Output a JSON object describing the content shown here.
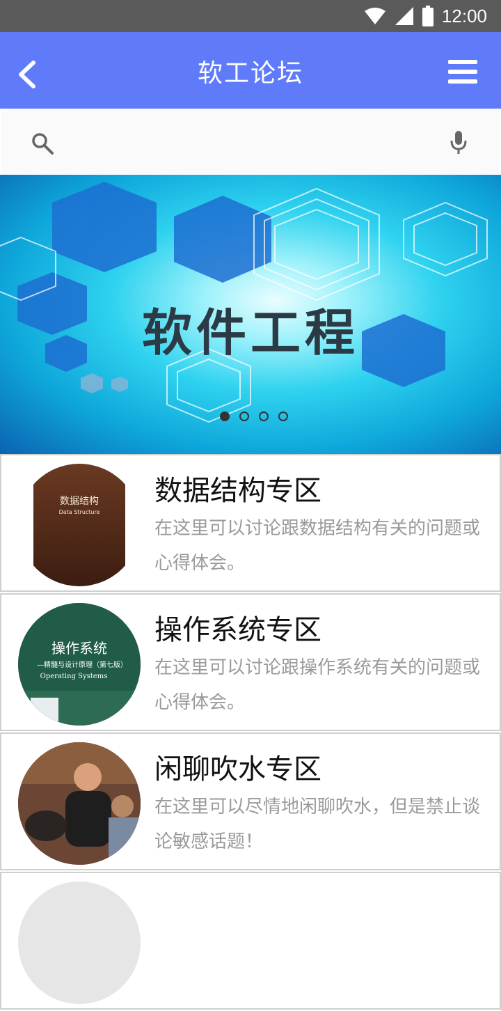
{
  "status_bar": {
    "time": "12:00"
  },
  "app_bar": {
    "title": "软工论坛"
  },
  "search": {
    "placeholder": ""
  },
  "banner": {
    "title": "软件工程",
    "pages": 4,
    "active_page": 1
  },
  "forums": [
    {
      "title": "数据结构专区",
      "description": "在这里可以讨论跟数据结构有关的问题或心得体会。",
      "cover_text": "数据结构",
      "cover_subtext": "Data Structure"
    },
    {
      "title": "操作系统专区",
      "description": "在这里可以讨论跟操作系统有关的问题或心得体会。",
      "cover_text": "操作系统",
      "cover_subtext": "—精髓与设计原理（第七版）",
      "cover_subtext2": "Operating Systems"
    },
    {
      "title": "闲聊吹水专区",
      "description": "在这里可以尽情地闲聊吹水，但是禁止谈论敏感话题！"
    }
  ],
  "colors": {
    "app_bar": "#5f7bfa",
    "status_bar": "#5a5a5a"
  },
  "icons": [
    "wifi-icon",
    "signal-icon",
    "battery-icon",
    "back-icon",
    "menu-icon",
    "search-icon",
    "mic-icon"
  ]
}
